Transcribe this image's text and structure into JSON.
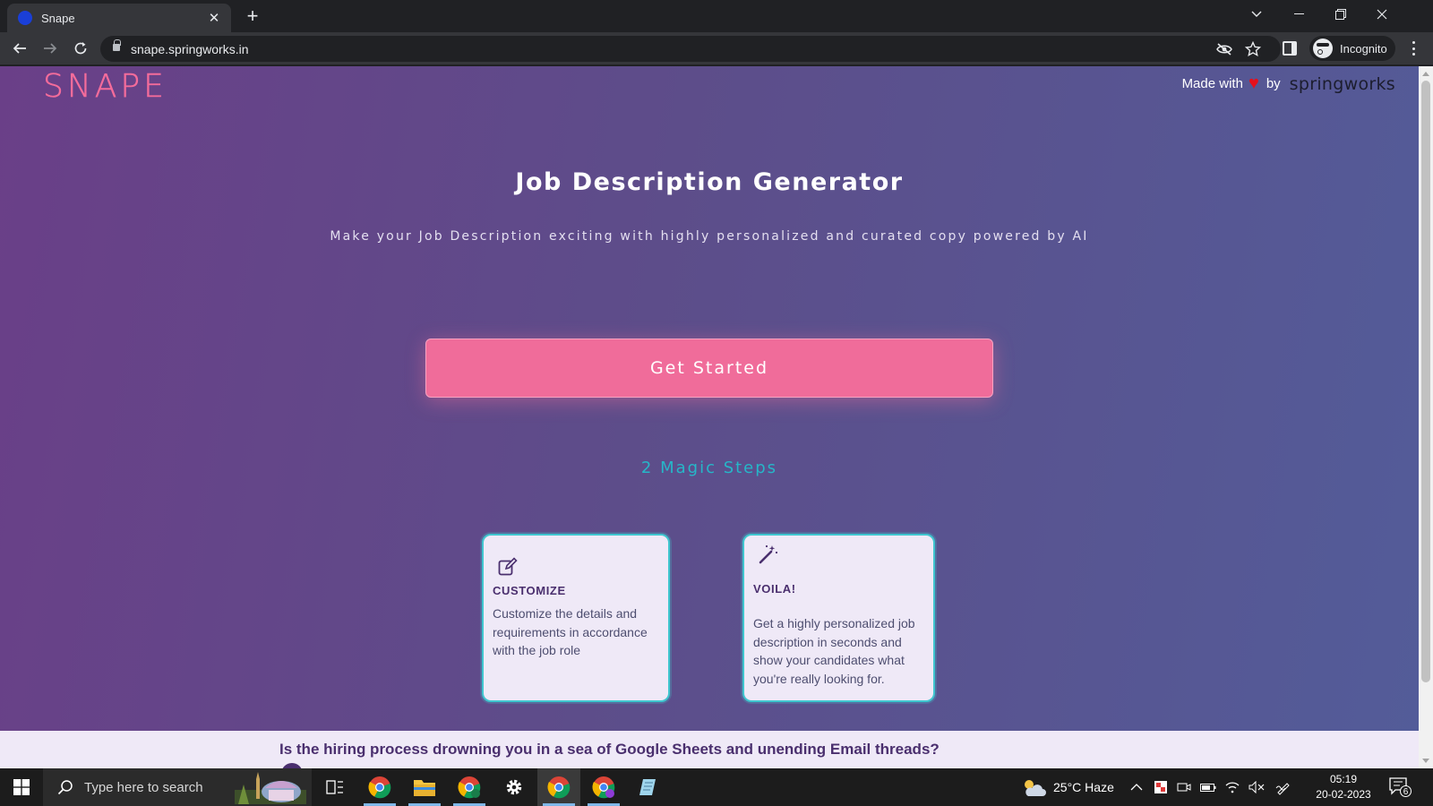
{
  "browser": {
    "tab_title": "Snape",
    "url": "snape.springworks.in",
    "profile_label": "Incognito"
  },
  "page": {
    "logo": "SNAPE",
    "credit": {
      "made_with": "Made with",
      "by": "by",
      "brand": "springworks"
    },
    "title": "Job Description Generator",
    "subtitle": "Make your Job Description exciting with highly personalized and curated copy powered by AI",
    "cta_label": "Get Started",
    "steps_title": "2 Magic Steps",
    "steps": [
      {
        "heading": "CUSTOMIZE",
        "text": "Customize the details and requirements in accordance with the job role",
        "icon": "edit-icon"
      },
      {
        "heading": "VOILA!",
        "text": "Get a highly personalized job description in seconds and show your candidates what you're really looking for.",
        "icon": "magic-wand-icon"
      }
    ],
    "banner_text": "Is the hiring process drowning you in a sea of Google Sheets and unending Email threads?"
  },
  "taskbar": {
    "search_placeholder": "Type here to search",
    "weather": "25°C  Haze",
    "time": "05:19",
    "date": "20-02-2023",
    "notification_count": "6"
  },
  "colors": {
    "brand_pink": "#f06c9a",
    "teal": "#26b6c8",
    "card_bg": "#efe9f7",
    "heading_purple": "#4a2f6e"
  }
}
